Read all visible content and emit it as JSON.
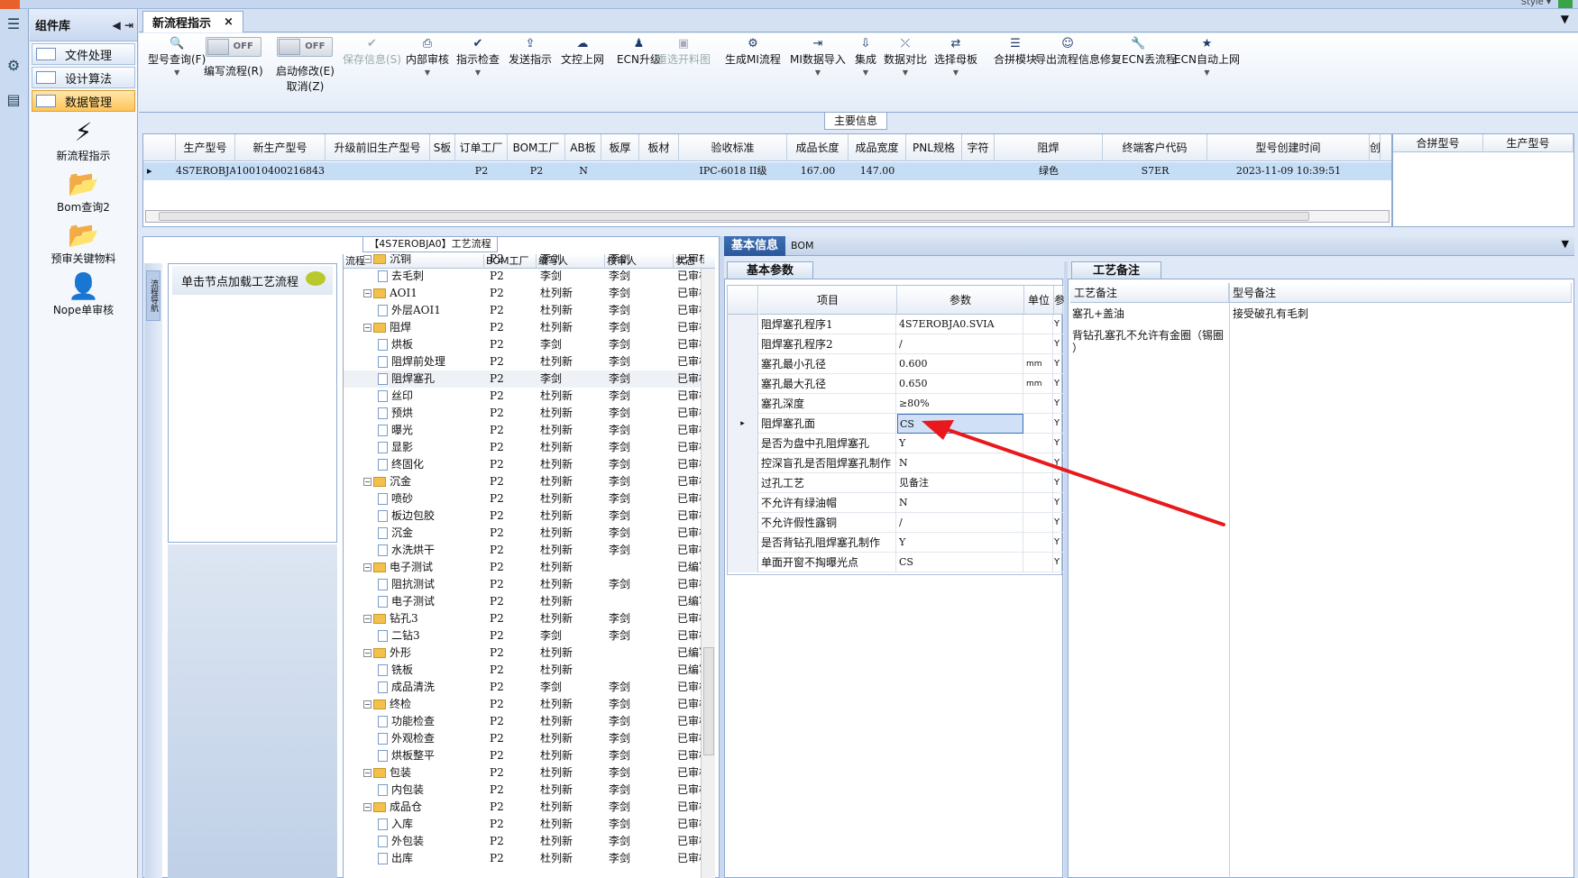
{
  "app": {
    "style_label": "Style ▾"
  },
  "left": {
    "title": "组件库",
    "nav": [
      {
        "label": "文件处理",
        "active": false
      },
      {
        "label": "设计算法",
        "active": false
      },
      {
        "label": "数据管理",
        "active": true
      }
    ],
    "tools": [
      {
        "label": "新流程指示",
        "icon": "lightning-icon"
      },
      {
        "label": "Bom查询2",
        "icon": "folder-icon"
      },
      {
        "label": "预审关键物料",
        "icon": "folder-icon"
      },
      {
        "label": "Nope单审核",
        "icon": "user-icon"
      }
    ]
  },
  "tab": {
    "label": "新流程指示",
    "close": "×"
  },
  "ribbon": {
    "items": [
      {
        "label": "型号查询(F)",
        "icon": "search-icon",
        "dd": true
      },
      {
        "label": "编写流程(R)",
        "toggle": "OFF"
      },
      {
        "label": "启动修改(E)",
        "label2": "取消(Z)",
        "toggle": "OFF"
      },
      {
        "label": "保存信息(S)",
        "icon": "check-icon",
        "disabled": true
      },
      {
        "label": "内部审核",
        "icon": "print-icon",
        "dd": true
      },
      {
        "label": "指示检查",
        "icon": "check-icon",
        "dd": true
      },
      {
        "label": "发送指示",
        "icon": "upload-icon"
      },
      {
        "label": "文控上网",
        "icon": "cloud-icon"
      },
      {
        "label": "ECN升级",
        "icon": "user-group-icon"
      },
      {
        "label": "重选开料图",
        "icon": "image-icon",
        "disabled": true
      },
      {
        "label": "生成MI流程",
        "icon": "gears-icon"
      },
      {
        "label": "MI数据导入",
        "icon": "import-icon",
        "dd": true
      },
      {
        "label": "集成",
        "icon": "download-icon",
        "dd": true
      },
      {
        "label": "数据对比",
        "icon": "compare-icon",
        "dd": true
      },
      {
        "label": "选择母板",
        "icon": "shuffle-icon",
        "dd": true
      },
      {
        "label": "合拼模块",
        "icon": "list-icon"
      },
      {
        "label": "导出流程信息",
        "icon": "smile-icon"
      },
      {
        "label": "修复ECN丢流程",
        "icon": "wrench-icon"
      },
      {
        "label": "ECN自动上网",
        "icon": "star-icon",
        "dd": true
      }
    ]
  },
  "main_info": {
    "title": "主要信息",
    "columns": [
      "生产型号",
      "新生产型号",
      "升级前旧生产型号",
      "S板",
      "订单工厂",
      "BOM工厂",
      "AB板",
      "板厚",
      "板材",
      "验收标准",
      "成品长度",
      "成品宽度",
      "PNL规格",
      "字符",
      "阻焊",
      "终端客户代码",
      "型号创建时间",
      "创"
    ],
    "row": [
      "4S7EROBJA0",
      "10010400216843",
      "",
      "",
      "P2",
      "P2",
      "N",
      "",
      "",
      "IPC-6018 II级",
      "167.00",
      "147.00",
      "",
      "",
      "绿色",
      "S7ER",
      "2023-11-09 10:39:51",
      ""
    ],
    "side_columns": [
      "合拼型号",
      "生产型号"
    ]
  },
  "flow": {
    "title": "【4S7EROBJA0】工艺流程",
    "vertical_tab": "流程导航",
    "node_prompt": "单击节点加载工艺流程",
    "columns": [
      "流程",
      "BOM工厂",
      "编写人",
      "核审人",
      "状态"
    ],
    "rows": [
      {
        "name": "沉铜",
        "level": 0,
        "folder": true,
        "bom": "P2",
        "writer": "李剑",
        "reviewer": "李剑",
        "status": "已审核"
      },
      {
        "name": "去毛刺",
        "level": 1,
        "folder": false,
        "bom": "P2",
        "writer": "李剑",
        "reviewer": "李剑",
        "status": "已审核"
      },
      {
        "name": "AOI1",
        "level": 0,
        "folder": true,
        "bom": "P2",
        "writer": "杜列新",
        "reviewer": "李剑",
        "status": "已审核"
      },
      {
        "name": "外层AOI1",
        "level": 1,
        "folder": false,
        "bom": "P2",
        "writer": "杜列新",
        "reviewer": "李剑",
        "status": "已审核"
      },
      {
        "name": "阻焊",
        "level": 0,
        "folder": true,
        "bom": "P2",
        "writer": "杜列新",
        "reviewer": "李剑",
        "status": "已审核"
      },
      {
        "name": "烘板",
        "level": 1,
        "folder": false,
        "bom": "P2",
        "writer": "李剑",
        "reviewer": "李剑",
        "status": "已审核"
      },
      {
        "name": "阻焊前处理",
        "level": 1,
        "folder": false,
        "bom": "P2",
        "writer": "杜列新",
        "reviewer": "李剑",
        "status": "已审核"
      },
      {
        "name": "阻焊塞孔",
        "level": 1,
        "folder": false,
        "bom": "P2",
        "writer": "李剑",
        "reviewer": "李剑",
        "status": "已审核",
        "selected": true
      },
      {
        "name": "丝印",
        "level": 1,
        "folder": false,
        "bom": "P2",
        "writer": "杜列新",
        "reviewer": "李剑",
        "status": "已审核"
      },
      {
        "name": "预烘",
        "level": 1,
        "folder": false,
        "bom": "P2",
        "writer": "杜列新",
        "reviewer": "李剑",
        "status": "已审核"
      },
      {
        "name": "曝光",
        "level": 1,
        "folder": false,
        "bom": "P2",
        "writer": "杜列新",
        "reviewer": "李剑",
        "status": "已审核"
      },
      {
        "name": "显影",
        "level": 1,
        "folder": false,
        "bom": "P2",
        "writer": "杜列新",
        "reviewer": "李剑",
        "status": "已审核"
      },
      {
        "name": "终固化",
        "level": 1,
        "folder": false,
        "bom": "P2",
        "writer": "杜列新",
        "reviewer": "李剑",
        "status": "已审核"
      },
      {
        "name": "沉金",
        "level": 0,
        "folder": true,
        "bom": "P2",
        "writer": "杜列新",
        "reviewer": "李剑",
        "status": "已审核"
      },
      {
        "name": "喷砂",
        "level": 1,
        "folder": false,
        "bom": "P2",
        "writer": "杜列新",
        "reviewer": "李剑",
        "status": "已审核"
      },
      {
        "name": "板边包胶",
        "level": 1,
        "folder": false,
        "bom": "P2",
        "writer": "杜列新",
        "reviewer": "李剑",
        "status": "已审核"
      },
      {
        "name": "沉金",
        "level": 1,
        "folder": false,
        "bom": "P2",
        "writer": "杜列新",
        "reviewer": "李剑",
        "status": "已审核"
      },
      {
        "name": "水洗烘干",
        "level": 1,
        "folder": false,
        "bom": "P2",
        "writer": "杜列新",
        "reviewer": "李剑",
        "status": "已审核"
      },
      {
        "name": "电子测试",
        "level": 0,
        "folder": true,
        "bom": "P2",
        "writer": "杜列新",
        "reviewer": "",
        "status": "已编写"
      },
      {
        "name": "阻抗测试",
        "level": 1,
        "folder": false,
        "bom": "P2",
        "writer": "杜列新",
        "reviewer": "李剑",
        "status": "已审核"
      },
      {
        "name": "电子测试",
        "level": 1,
        "folder": false,
        "bom": "P2",
        "writer": "杜列新",
        "reviewer": "",
        "status": "已编写"
      },
      {
        "name": "钻孔3",
        "level": 0,
        "folder": true,
        "bom": "P2",
        "writer": "杜列新",
        "reviewer": "李剑",
        "status": "已审核"
      },
      {
        "name": "二钻3",
        "level": 1,
        "folder": false,
        "bom": "P2",
        "writer": "李剑",
        "reviewer": "李剑",
        "status": "已审核"
      },
      {
        "name": "外形",
        "level": 0,
        "folder": true,
        "bom": "P2",
        "writer": "杜列新",
        "reviewer": "",
        "status": "已编写"
      },
      {
        "name": "铣板",
        "level": 1,
        "folder": false,
        "bom": "P2",
        "writer": "杜列新",
        "reviewer": "",
        "status": "已编写"
      },
      {
        "name": "成品清洗",
        "level": 1,
        "folder": false,
        "bom": "P2",
        "writer": "李剑",
        "reviewer": "李剑",
        "status": "已审核"
      },
      {
        "name": "终检",
        "level": 0,
        "folder": true,
        "bom": "P2",
        "writer": "杜列新",
        "reviewer": "李剑",
        "status": "已审核"
      },
      {
        "name": "功能检查",
        "level": 1,
        "folder": false,
        "bom": "P2",
        "writer": "杜列新",
        "reviewer": "李剑",
        "status": "已审核"
      },
      {
        "name": "外观检查",
        "level": 1,
        "folder": false,
        "bom": "P2",
        "writer": "杜列新",
        "reviewer": "李剑",
        "status": "已审核"
      },
      {
        "name": "烘板整平",
        "level": 1,
        "folder": false,
        "bom": "P2",
        "writer": "杜列新",
        "reviewer": "李剑",
        "status": "已审核"
      },
      {
        "name": "包装",
        "level": 0,
        "folder": true,
        "bom": "P2",
        "writer": "杜列新",
        "reviewer": "李剑",
        "status": "已审核"
      },
      {
        "name": "内包装",
        "level": 1,
        "folder": false,
        "bom": "P2",
        "writer": "杜列新",
        "reviewer": "李剑",
        "status": "已审核"
      },
      {
        "name": "成品仓",
        "level": 0,
        "folder": true,
        "bom": "P2",
        "writer": "杜列新",
        "reviewer": "李剑",
        "status": "已审核"
      },
      {
        "name": "入库",
        "level": 1,
        "folder": false,
        "bom": "P2",
        "writer": "杜列新",
        "reviewer": "李剑",
        "status": "已审核"
      },
      {
        "name": "外包装",
        "level": 1,
        "folder": false,
        "bom": "P2",
        "writer": "杜列新",
        "reviewer": "李剑",
        "status": "已审核"
      },
      {
        "name": "出库",
        "level": 1,
        "folder": false,
        "bom": "P2",
        "writer": "杜列新",
        "reviewer": "李剑",
        "status": "已审核"
      }
    ]
  },
  "basic": {
    "tabs": [
      "基本信息",
      "BOM"
    ],
    "section": "基本参数",
    "columns": [
      "项目",
      "参数",
      "单位",
      "参"
    ],
    "rows": [
      {
        "item": "阻焊塞孔程序1",
        "param": "4S7EROBJA0.SVIA",
        "unit": "",
        "flag": "Y"
      },
      {
        "item": "阻焊塞孔程序2",
        "param": "/",
        "unit": "",
        "flag": "Y"
      },
      {
        "item": "塞孔最小孔径",
        "param": "0.600",
        "unit": "mm",
        "flag": "Y"
      },
      {
        "item": "塞孔最大孔径",
        "param": "0.650",
        "unit": "mm",
        "flag": "Y"
      },
      {
        "item": "塞孔深度",
        "param": "≥80%",
        "unit": "",
        "flag": "Y"
      },
      {
        "item": "阻焊塞孔面",
        "param": "CS",
        "unit": "",
        "flag": "Y",
        "selected": true
      },
      {
        "item": "是否为盘中孔阻焊塞孔",
        "param": "Y",
        "unit": "",
        "flag": "Y"
      },
      {
        "item": "控深盲孔是否阻焊塞孔制作",
        "param": "N",
        "unit": "",
        "flag": "Y"
      },
      {
        "item": "过孔工艺",
        "param": "见备注",
        "unit": "",
        "flag": "Y"
      },
      {
        "item": "不允许有绿油帽",
        "param": "N",
        "unit": "",
        "flag": "Y"
      },
      {
        "item": "不允许假性露铜",
        "param": "/",
        "unit": "",
        "flag": "Y"
      },
      {
        "item": "是否背钻孔阻焊塞孔制作",
        "param": "Y",
        "unit": "",
        "flag": "Y"
      },
      {
        "item": "单面开窗不掏曝光点",
        "param": "CS",
        "unit": "",
        "flag": "Y"
      }
    ]
  },
  "remarks": {
    "section": "工艺备注",
    "col1": "工艺备注",
    "col2": "型号备注",
    "process_remark_1": "塞孔+盖油",
    "process_remark_2": "背钻孔塞孔不允许有金圈（锡圈",
    "process_remark_3": "）",
    "model_remark": "接受破孔有毛刺"
  },
  "colors": {
    "selection": "#c6ddf6",
    "annotation_arrow": "#e8191c",
    "active_nav": "#ffc45a"
  }
}
